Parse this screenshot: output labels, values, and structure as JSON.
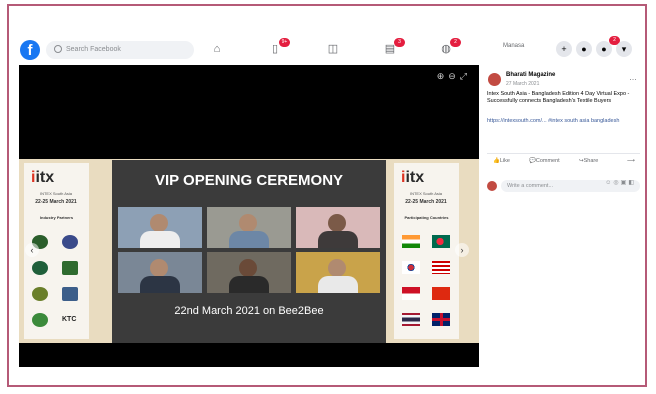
{
  "topbar": {
    "logo": "f",
    "search_placeholder": "Search Facebook",
    "notification_counts": [
      "9+",
      "3",
      "2"
    ],
    "user_name": "Manasa",
    "messenger_count": "2"
  },
  "post": {
    "page_name": "Bharati Magazine",
    "date": "27 March 2021",
    "text": "Intex South Asia - Bangladesh Edition 4 Day Virtual Expo - Successfully connects Bangladesh's Textile Buyers",
    "link": "https://intexsouth.com/... #intex south asia bangladesh",
    "like_label": "Like",
    "comment_label": "Comment",
    "share_label": "Share",
    "comment_placeholder": "Write a comment..."
  },
  "slide": {
    "logo": "itx",
    "logo_sub": "INTEX South Asia",
    "date_range": "22-25 March 2021",
    "left_heading": "Industry Partners",
    "right_heading": "Participating Countries",
    "title": "VIP OPENING CEREMONY",
    "date_line": "22nd March 2021 on Bee2Bee"
  },
  "colors": {
    "accent": "#1877f2",
    "badge": "#e41e3f",
    "frame": "#b55a77"
  }
}
